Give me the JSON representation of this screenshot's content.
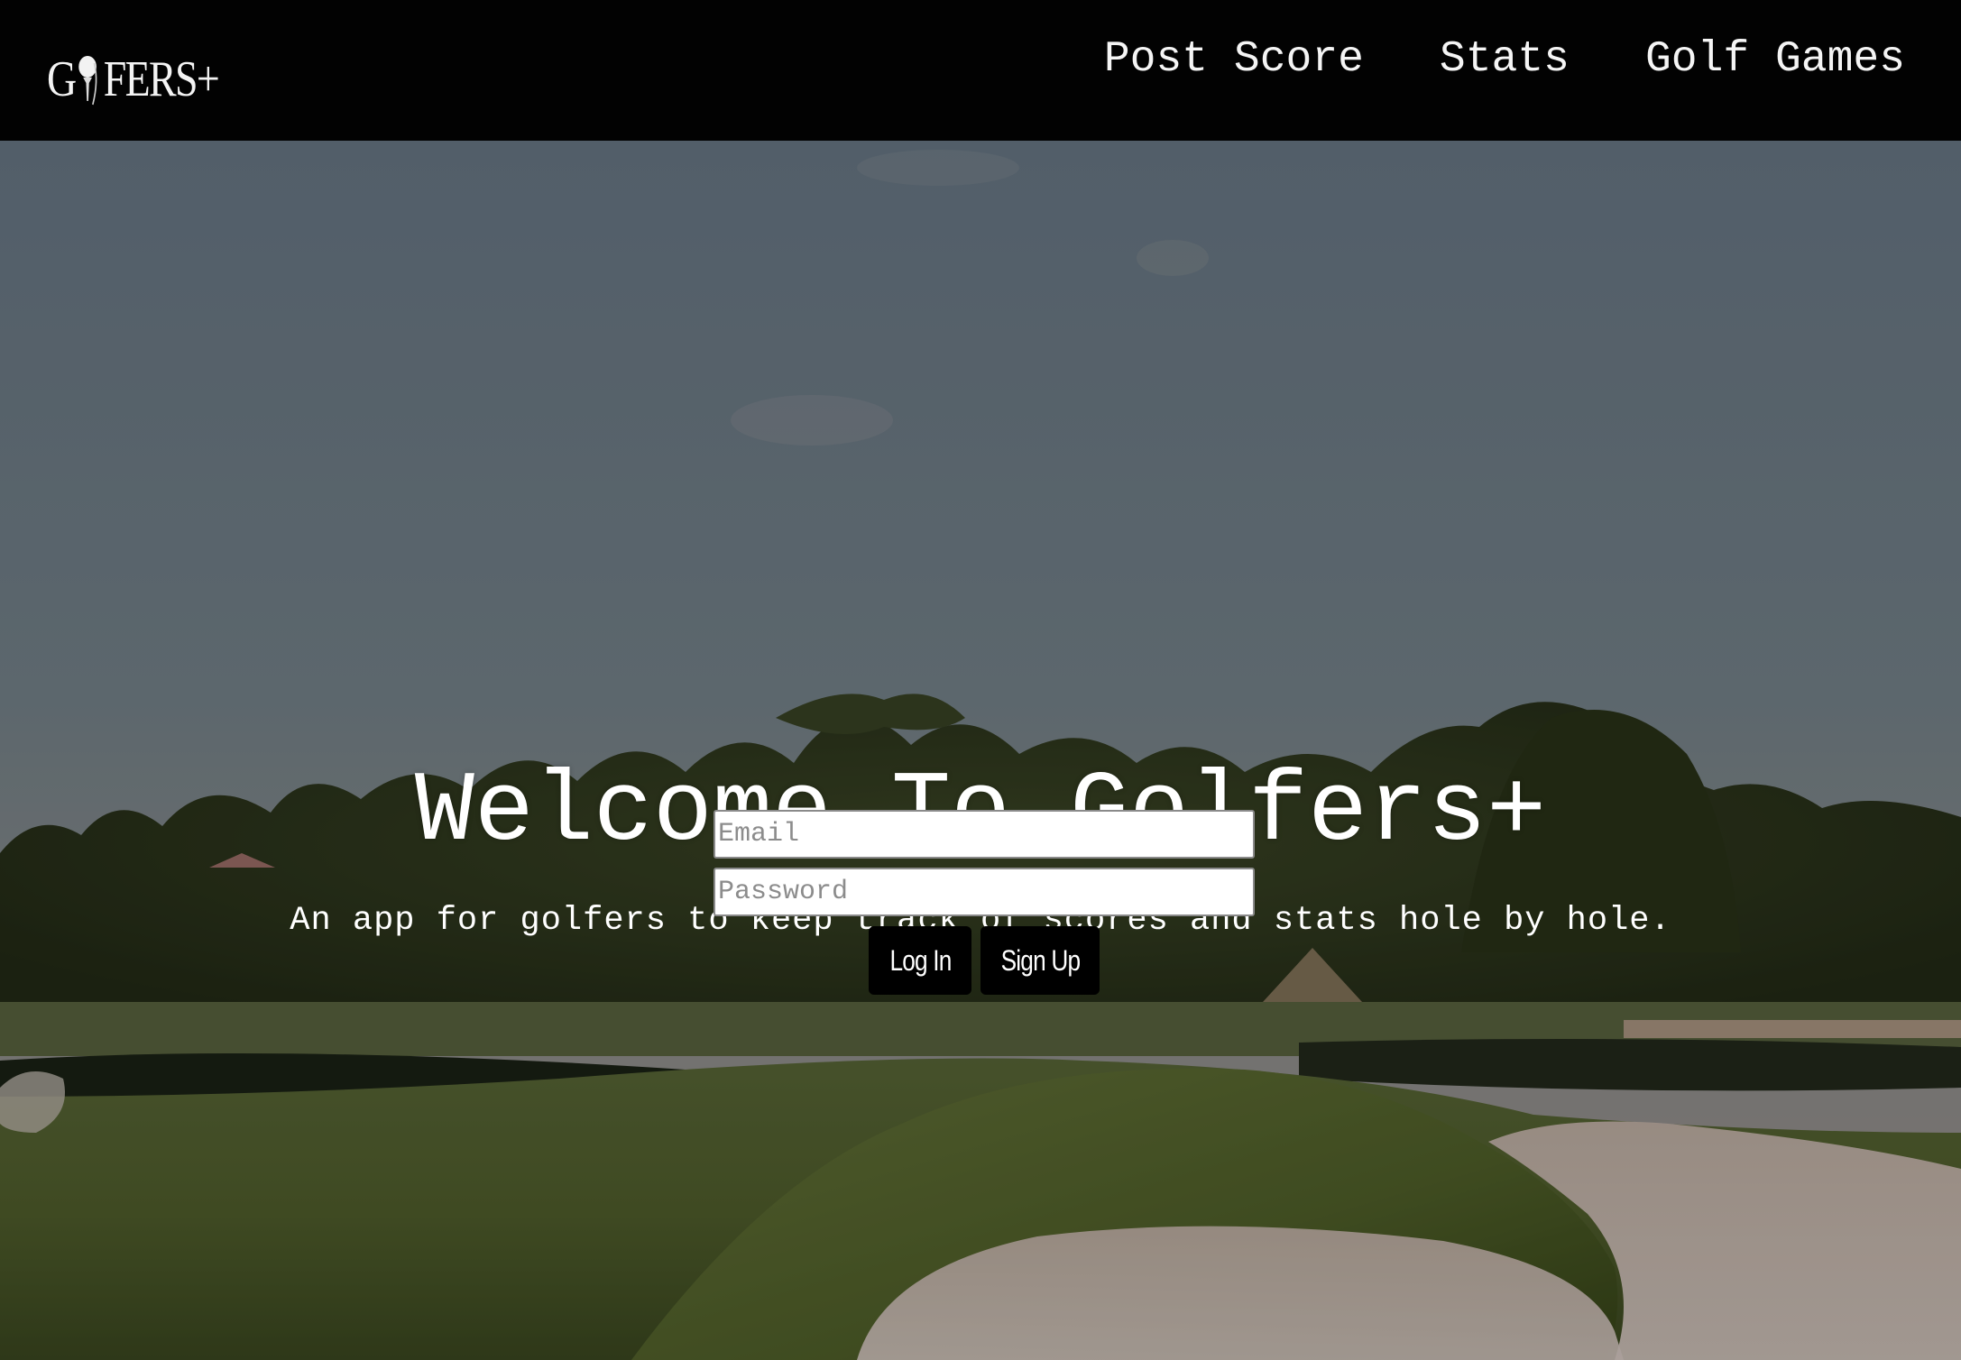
{
  "navbar": {
    "logo": {
      "text_left": "G",
      "text_right": "FERS+"
    },
    "links": [
      {
        "label": "Post Score"
      },
      {
        "label": "Stats"
      },
      {
        "label": "Golf Games"
      }
    ]
  },
  "hero": {
    "background": "golf course at dusk",
    "title": "Welcome To Golfers+",
    "subtitle": "An app for golfers to keep track of scores and stats hole by hole.",
    "form": {
      "email_placeholder": "Email",
      "password_placeholder": "Password",
      "login_label": "Log In",
      "signup_label": "Sign Up"
    }
  },
  "colors": {
    "navbar_bg": "#020202",
    "text": "#ffffff",
    "button_bg": "#000000"
  }
}
